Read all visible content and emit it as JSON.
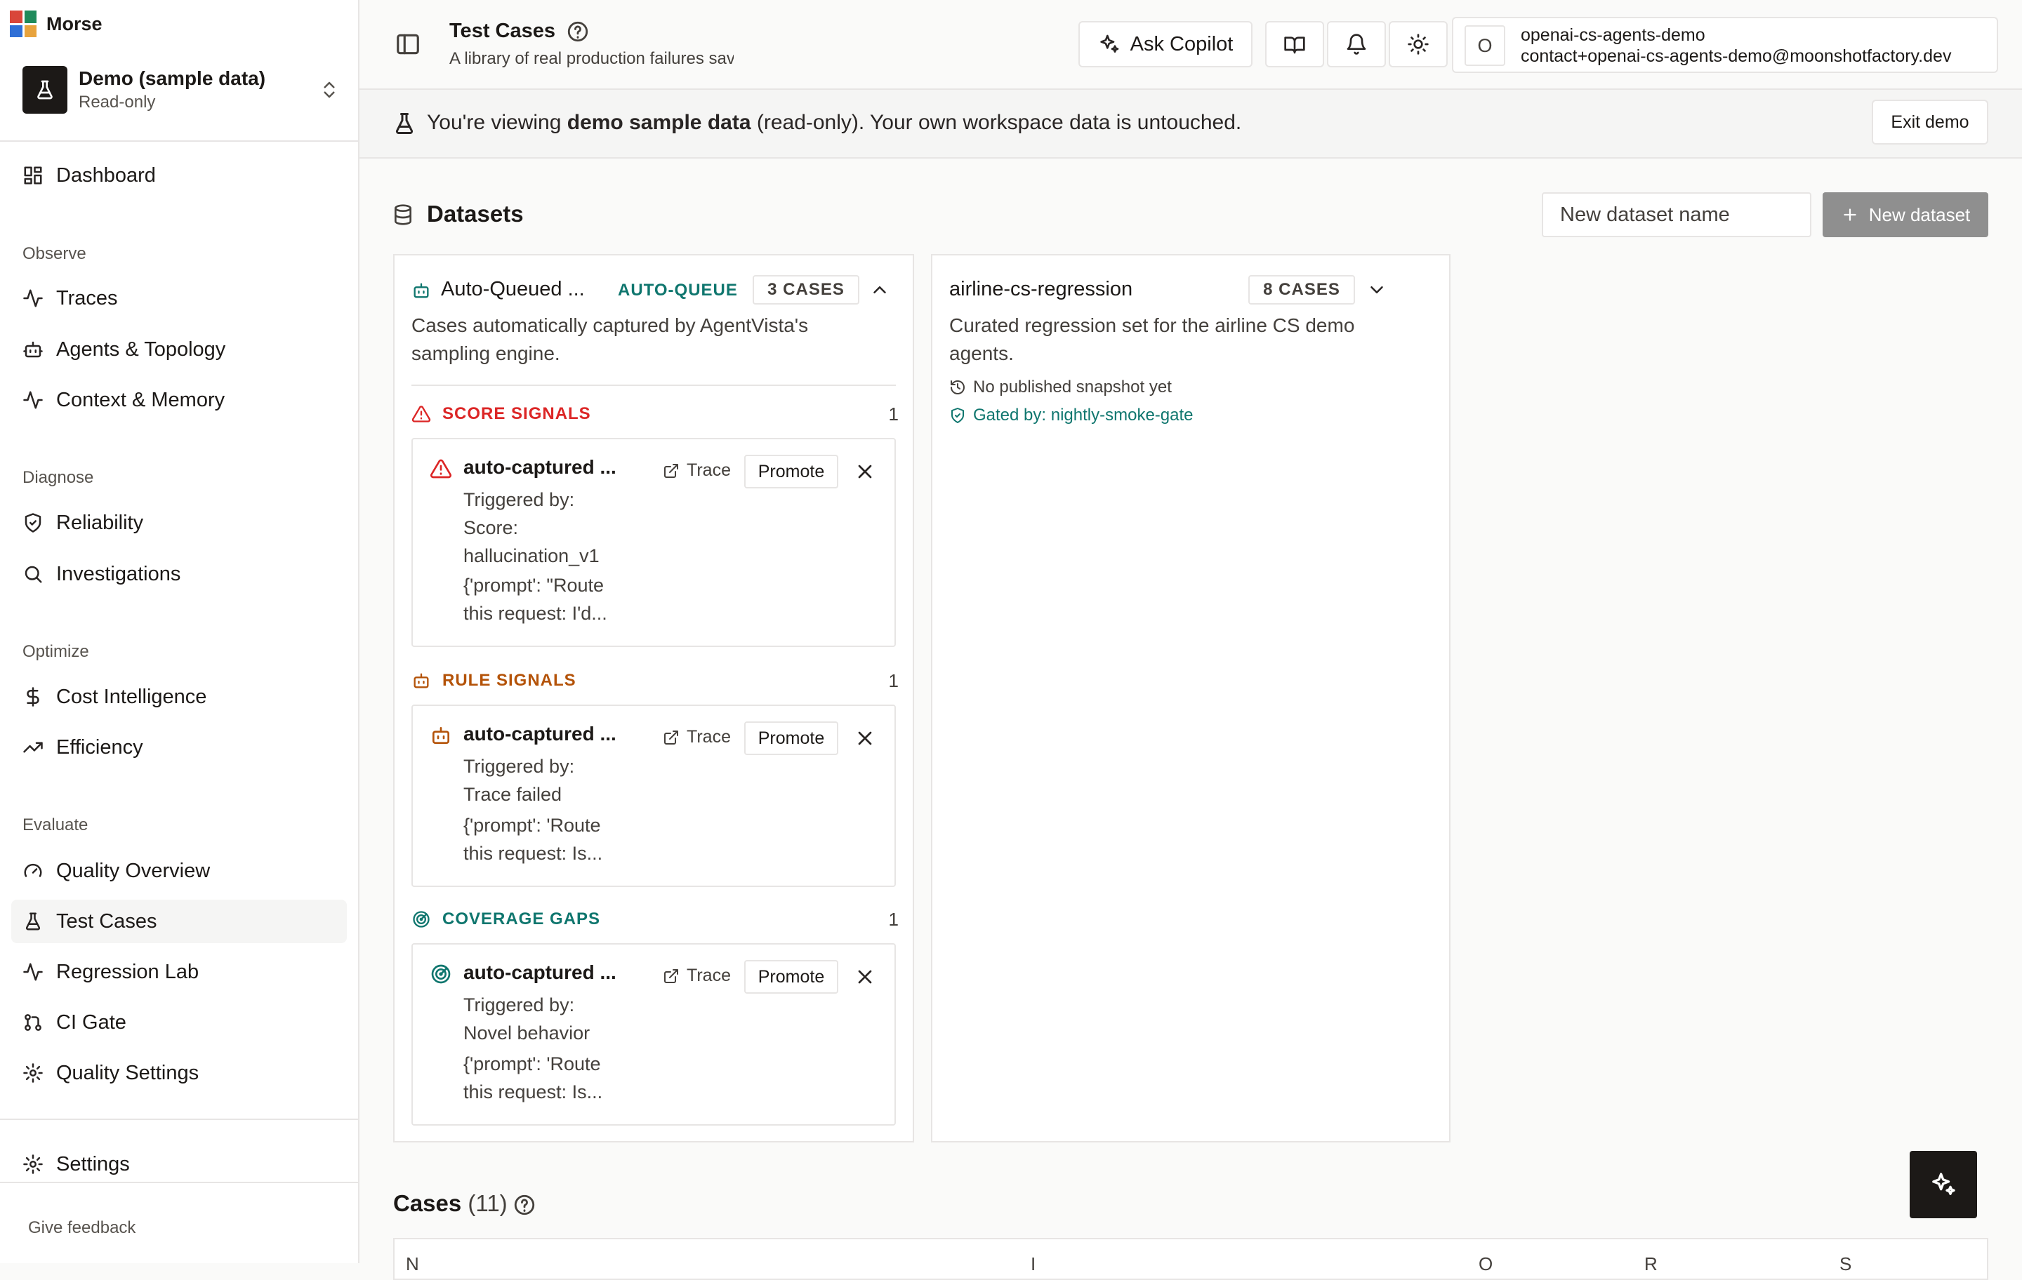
{
  "colors": {
    "score_signals": "#dc2626",
    "rule_signals": "#b45309",
    "coverage_gaps": "#0f766e",
    "auto_queue": "#0f766e",
    "primary_disabled": "#8f8f8f",
    "logo": [
      "#d9463a",
      "#1f8a5b",
      "#2f6fd6",
      "#e8a33d"
    ]
  },
  "sidebar": {
    "brand": "Morse",
    "workspace": {
      "name": "Demo (sample data)",
      "sub": "Read-only"
    },
    "dashboard": {
      "label": "Dashboard",
      "icon": "dashboard-icon"
    },
    "sections": {
      "observe": "Observe",
      "diagnose": "Diagnose",
      "optimize": "Optimize",
      "evaluate": "Evaluate"
    },
    "items": {
      "traces": "Traces",
      "agents": "Agents & Topology",
      "context": "Context & Memory",
      "reliability": "Reliability",
      "investigations": "Investigations",
      "cost": "Cost Intelligence",
      "efficiency": "Efficiency",
      "quality_overview": "Quality Overview",
      "test_cases": "Test Cases",
      "regression_lab": "Regression Lab",
      "ci_gate": "CI Gate",
      "quality_settings": "Quality Settings",
      "settings": "Settings"
    },
    "feedback": "Give feedback"
  },
  "header": {
    "title": "Test Cases",
    "subtitle": "A library of real production failures saved as canonical tests to never regress ...",
    "ask_copilot": "Ask Copilot",
    "account": {
      "initial": "O",
      "name": "openai-cs-agents-demo",
      "email": "contact+openai-cs-agents-demo@moonshotfactory.dev"
    }
  },
  "banner": {
    "prefix": "You're viewing ",
    "bold": "demo sample data",
    "suffix": " (read-only). Your own workspace data is untouched.",
    "exit": "Exit demo"
  },
  "datasets": {
    "title": "Datasets",
    "new_name_placeholder": "New dataset name",
    "new_button": "New dataset",
    "auto_queue": {
      "title": "Auto-Queued ...",
      "tag": "AUTO-QUEUE",
      "count": "3 CASES",
      "description_line1": "Cases automatically captured by AgentVista's",
      "description_line2": "sampling engine.",
      "groups": [
        {
          "label": "SCORE SIGNALS",
          "count": "1",
          "case": {
            "title": "auto-captured ...",
            "triggered": "Triggered by:\nScore:\nhallucination_v1",
            "prompt": "{'prompt': \"Route\nthis request: I'd...",
            "trace": "Trace",
            "promote": "Promote"
          }
        },
        {
          "label": "RULE SIGNALS",
          "count": "1",
          "case": {
            "title": "auto-captured ...",
            "triggered": "Triggered by:\nTrace failed",
            "prompt": "{'prompt': 'Route\nthis request: Is...",
            "trace": "Trace",
            "promote": "Promote"
          }
        },
        {
          "label": "COVERAGE GAPS",
          "count": "1",
          "case": {
            "title": "auto-captured ...",
            "triggered": "Triggered by:\nNovel behavior",
            "prompt": "{'prompt': 'Route\nthis request: Is...",
            "trace": "Trace",
            "promote": "Promote"
          }
        }
      ]
    },
    "airline": {
      "title": "airline-cs-regression",
      "count": "8 CASES",
      "description_line1": "Curated regression set for the airline CS demo",
      "description_line2": "agents.",
      "snapshot": "No published snapshot yet",
      "gated": "Gated by: nightly-smoke-gate"
    }
  },
  "cases": {
    "title": "Cases",
    "count": "(11)",
    "columns": [
      "N",
      "I",
      "O",
      "R",
      "S"
    ]
  }
}
